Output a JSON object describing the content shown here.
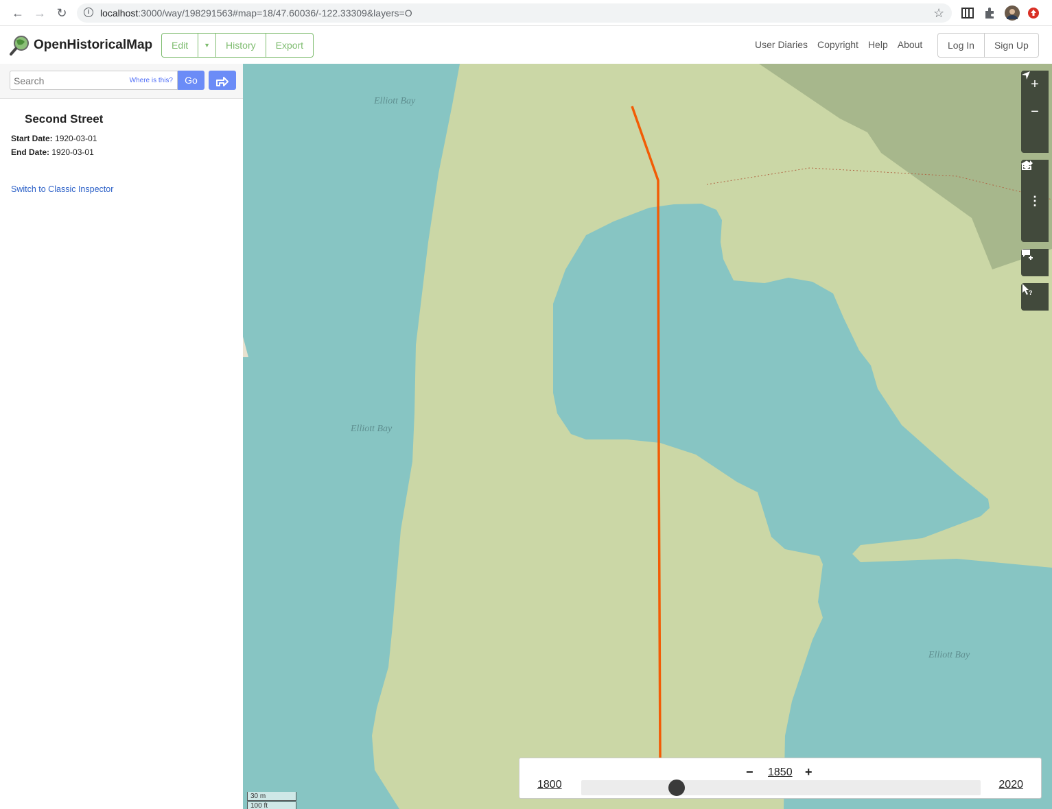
{
  "browser": {
    "url_host": "localhost",
    "url_rest": ":3000/way/198291563#map=18/47.60036/-122.33309&layers=O"
  },
  "header": {
    "site_name": "OpenHistoricalMap",
    "edit_label": "Edit",
    "history_label": "History",
    "export_label": "Export",
    "nav": [
      "User Diaries",
      "Copyright",
      "Help",
      "About"
    ],
    "login_label": "Log In",
    "signup_label": "Sign Up",
    "accent_color": "#7ebc6f"
  },
  "sidebar": {
    "search_placeholder": "Search",
    "where_label": "Where is this?",
    "go_label": "Go",
    "feature_title": "Second Street",
    "start_date_label": "Start Date:",
    "start_date": "1920-03-01",
    "end_date_label": "End Date:",
    "end_date": "1920-03-01",
    "classic_link": "Switch to Classic Inspector"
  },
  "map": {
    "water_labels": [
      "Elliott Bay",
      "Elliott Bay",
      "Elliott Bay"
    ],
    "colors": {
      "water": "#87c5c3",
      "land": "#cbd7a6",
      "park": "#a7b78c",
      "road": "#f25c05"
    },
    "controls": [
      "zoom-in-icon",
      "zoom-out-icon",
      "locate-icon",
      "layers-icon",
      "info-icon",
      "share-icon",
      "note-icon",
      "query-icon"
    ],
    "scale_metric": "30 m",
    "scale_imperial": "100 ft"
  },
  "time_slider": {
    "min": "1800",
    "max": "2020",
    "current": "1850",
    "minus": "−",
    "plus": "+",
    "position": 0.2273
  }
}
